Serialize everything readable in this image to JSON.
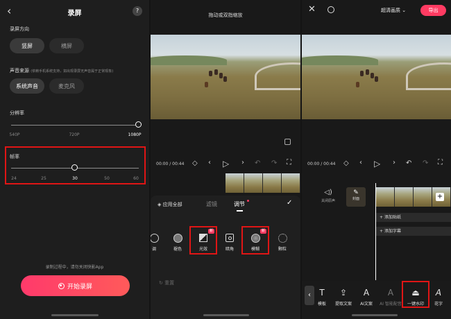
{
  "screen1": {
    "title": "录屏",
    "help": "?",
    "orientation": {
      "label": "录屏方向",
      "options": [
        "竖屏",
        "横屏"
      ],
      "selected": 0
    },
    "audio": {
      "label": "声音来源",
      "note": "(依赖手机系统支持，如出现录屏无声音属于正常现象)",
      "options": [
        "系统声音",
        "麦克风"
      ],
      "selected": 0
    },
    "resolution": {
      "label": "分辨率",
      "ticks": [
        "540P",
        "720P",
        "1080P"
      ],
      "selected_index": 2
    },
    "framerate": {
      "label": "帧率",
      "ticks": [
        "24",
        "25",
        "30",
        "50",
        "60"
      ],
      "selected_index": 2
    },
    "hint": "录制过程中，请勿关闭快影App",
    "start_button": "开始录屏"
  },
  "screen2": {
    "top_hint": "拖动或双指缩放",
    "time": "00:00 / 00:44",
    "apply_all": "应用全部",
    "tabs": [
      "滤镜",
      "调节"
    ],
    "active_tab": 1,
    "tools": [
      {
        "label": "调"
      },
      {
        "label": "褪色"
      },
      {
        "label": "光效",
        "badge": "新"
      },
      {
        "label": "暗角"
      },
      {
        "label": "模糊",
        "badge": "新"
      },
      {
        "label": "颗粒"
      }
    ],
    "reset": "重置"
  },
  "screen3": {
    "quality": "超清画质",
    "export": "导出",
    "time": "00:00 / 00:44",
    "mute": "关闭原声",
    "cover": "封面",
    "add_sticker": "添加贴纸",
    "add_caption": "添加字幕",
    "tools": [
      "模板",
      "提取文案",
      "AI文案",
      "AI 智能配音",
      "一键水印",
      "花字"
    ],
    "tool_icons": [
      "T",
      "upload-icon",
      "A",
      "A",
      "stamp-icon",
      "A"
    ]
  },
  "colors": {
    "accent": "#ff3b62",
    "highlight": "#e01515"
  }
}
